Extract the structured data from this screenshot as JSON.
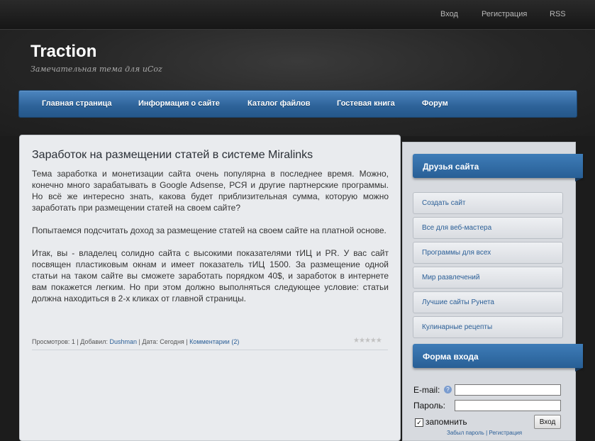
{
  "topbar": {
    "login": "Вход",
    "register": "Регистрация",
    "rss": "RSS"
  },
  "site": {
    "title": "Traction",
    "subtitle": "Замечательная тема для uCoz"
  },
  "nav": {
    "items": [
      "Главная страница",
      "Информация о сайте",
      "Каталог файлов",
      "Гостевая книга",
      "Форум"
    ]
  },
  "post": {
    "title": "Заработок на размещении статей в системе Miralinks",
    "paragraphs": [
      "Тема заработка и монетизации сайта очень популярна в последнее время. Можно, конечно много зарабатывать в Google Adsense, РСЯ и другие партнерские программы. Но всё же интересно знать, какова будет приблизительная сумма, которую можно заработать при размещении статей на своем сайте?",
      "Попытаемся подсчитать доход за размещение статей на своем сайте на платной основе.",
      "Итак, вы - владелец солидно сайта с высокими показателями тИЦ и PR. У вас сайт посвящен пластиковым окнам и имеет показатель тИЦ 1500. За размещение одной статьи на таком сайте вы сможете заработать порядком 40$, и заработок в интернете вам покажется легким. Но при этом должно выполняться следующее условие: статьи должна находиться в 2-х кликах от главной страницы."
    ],
    "meta": {
      "views": "Просмотров: 1",
      "added_by_label": "Добавил:",
      "author": "Dushman",
      "date": "Дата: Сегодня",
      "comments": "Комментарии (2)"
    },
    "rating": 0
  },
  "sidebar": {
    "friends": {
      "title": "Друзья сайта",
      "items": [
        "Создать сайт",
        "Все для веб-мастера",
        "Программы для всех",
        "Мир развлечений",
        "Лучшие сайты Рунета",
        "Кулинарные рецепты"
      ]
    },
    "login": {
      "title": "Форма входа",
      "email_label": "E-mail:",
      "password_label": "Пароль:",
      "email_value": "",
      "password_value": "",
      "remember_label": "запомнить",
      "button": "Вход",
      "forgot": "Забыл пароль | Регистрация"
    }
  }
}
